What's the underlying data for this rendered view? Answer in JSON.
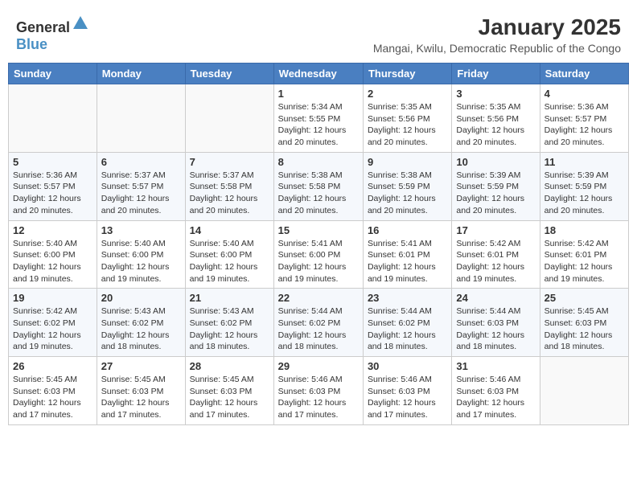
{
  "header": {
    "logo_general": "General",
    "logo_blue": "Blue",
    "month_year": "January 2025",
    "location": "Mangai, Kwilu, Democratic Republic of the Congo"
  },
  "weekdays": [
    "Sunday",
    "Monday",
    "Tuesday",
    "Wednesday",
    "Thursday",
    "Friday",
    "Saturday"
  ],
  "weeks": [
    [
      {
        "day": "",
        "sunrise": "",
        "sunset": "",
        "daylight": ""
      },
      {
        "day": "",
        "sunrise": "",
        "sunset": "",
        "daylight": ""
      },
      {
        "day": "",
        "sunrise": "",
        "sunset": "",
        "daylight": ""
      },
      {
        "day": "1",
        "sunrise": "Sunrise: 5:34 AM",
        "sunset": "Sunset: 5:55 PM",
        "daylight": "Daylight: 12 hours and 20 minutes."
      },
      {
        "day": "2",
        "sunrise": "Sunrise: 5:35 AM",
        "sunset": "Sunset: 5:56 PM",
        "daylight": "Daylight: 12 hours and 20 minutes."
      },
      {
        "day": "3",
        "sunrise": "Sunrise: 5:35 AM",
        "sunset": "Sunset: 5:56 PM",
        "daylight": "Daylight: 12 hours and 20 minutes."
      },
      {
        "day": "4",
        "sunrise": "Sunrise: 5:36 AM",
        "sunset": "Sunset: 5:57 PM",
        "daylight": "Daylight: 12 hours and 20 minutes."
      }
    ],
    [
      {
        "day": "5",
        "sunrise": "Sunrise: 5:36 AM",
        "sunset": "Sunset: 5:57 PM",
        "daylight": "Daylight: 12 hours and 20 minutes."
      },
      {
        "day": "6",
        "sunrise": "Sunrise: 5:37 AM",
        "sunset": "Sunset: 5:57 PM",
        "daylight": "Daylight: 12 hours and 20 minutes."
      },
      {
        "day": "7",
        "sunrise": "Sunrise: 5:37 AM",
        "sunset": "Sunset: 5:58 PM",
        "daylight": "Daylight: 12 hours and 20 minutes."
      },
      {
        "day": "8",
        "sunrise": "Sunrise: 5:38 AM",
        "sunset": "Sunset: 5:58 PM",
        "daylight": "Daylight: 12 hours and 20 minutes."
      },
      {
        "day": "9",
        "sunrise": "Sunrise: 5:38 AM",
        "sunset": "Sunset: 5:59 PM",
        "daylight": "Daylight: 12 hours and 20 minutes."
      },
      {
        "day": "10",
        "sunrise": "Sunrise: 5:39 AM",
        "sunset": "Sunset: 5:59 PM",
        "daylight": "Daylight: 12 hours and 20 minutes."
      },
      {
        "day": "11",
        "sunrise": "Sunrise: 5:39 AM",
        "sunset": "Sunset: 5:59 PM",
        "daylight": "Daylight: 12 hours and 20 minutes."
      }
    ],
    [
      {
        "day": "12",
        "sunrise": "Sunrise: 5:40 AM",
        "sunset": "Sunset: 6:00 PM",
        "daylight": "Daylight: 12 hours and 19 minutes."
      },
      {
        "day": "13",
        "sunrise": "Sunrise: 5:40 AM",
        "sunset": "Sunset: 6:00 PM",
        "daylight": "Daylight: 12 hours and 19 minutes."
      },
      {
        "day": "14",
        "sunrise": "Sunrise: 5:40 AM",
        "sunset": "Sunset: 6:00 PM",
        "daylight": "Daylight: 12 hours and 19 minutes."
      },
      {
        "day": "15",
        "sunrise": "Sunrise: 5:41 AM",
        "sunset": "Sunset: 6:00 PM",
        "daylight": "Daylight: 12 hours and 19 minutes."
      },
      {
        "day": "16",
        "sunrise": "Sunrise: 5:41 AM",
        "sunset": "Sunset: 6:01 PM",
        "daylight": "Daylight: 12 hours and 19 minutes."
      },
      {
        "day": "17",
        "sunrise": "Sunrise: 5:42 AM",
        "sunset": "Sunset: 6:01 PM",
        "daylight": "Daylight: 12 hours and 19 minutes."
      },
      {
        "day": "18",
        "sunrise": "Sunrise: 5:42 AM",
        "sunset": "Sunset: 6:01 PM",
        "daylight": "Daylight: 12 hours and 19 minutes."
      }
    ],
    [
      {
        "day": "19",
        "sunrise": "Sunrise: 5:42 AM",
        "sunset": "Sunset: 6:02 PM",
        "daylight": "Daylight: 12 hours and 19 minutes."
      },
      {
        "day": "20",
        "sunrise": "Sunrise: 5:43 AM",
        "sunset": "Sunset: 6:02 PM",
        "daylight": "Daylight: 12 hours and 18 minutes."
      },
      {
        "day": "21",
        "sunrise": "Sunrise: 5:43 AM",
        "sunset": "Sunset: 6:02 PM",
        "daylight": "Daylight: 12 hours and 18 minutes."
      },
      {
        "day": "22",
        "sunrise": "Sunrise: 5:44 AM",
        "sunset": "Sunset: 6:02 PM",
        "daylight": "Daylight: 12 hours and 18 minutes."
      },
      {
        "day": "23",
        "sunrise": "Sunrise: 5:44 AM",
        "sunset": "Sunset: 6:02 PM",
        "daylight": "Daylight: 12 hours and 18 minutes."
      },
      {
        "day": "24",
        "sunrise": "Sunrise: 5:44 AM",
        "sunset": "Sunset: 6:03 PM",
        "daylight": "Daylight: 12 hours and 18 minutes."
      },
      {
        "day": "25",
        "sunrise": "Sunrise: 5:45 AM",
        "sunset": "Sunset: 6:03 PM",
        "daylight": "Daylight: 12 hours and 18 minutes."
      }
    ],
    [
      {
        "day": "26",
        "sunrise": "Sunrise: 5:45 AM",
        "sunset": "Sunset: 6:03 PM",
        "daylight": "Daylight: 12 hours and 17 minutes."
      },
      {
        "day": "27",
        "sunrise": "Sunrise: 5:45 AM",
        "sunset": "Sunset: 6:03 PM",
        "daylight": "Daylight: 12 hours and 17 minutes."
      },
      {
        "day": "28",
        "sunrise": "Sunrise: 5:45 AM",
        "sunset": "Sunset: 6:03 PM",
        "daylight": "Daylight: 12 hours and 17 minutes."
      },
      {
        "day": "29",
        "sunrise": "Sunrise: 5:46 AM",
        "sunset": "Sunset: 6:03 PM",
        "daylight": "Daylight: 12 hours and 17 minutes."
      },
      {
        "day": "30",
        "sunrise": "Sunrise: 5:46 AM",
        "sunset": "Sunset: 6:03 PM",
        "daylight": "Daylight: 12 hours and 17 minutes."
      },
      {
        "day": "31",
        "sunrise": "Sunrise: 5:46 AM",
        "sunset": "Sunset: 6:03 PM",
        "daylight": "Daylight: 12 hours and 17 minutes."
      },
      {
        "day": "",
        "sunrise": "",
        "sunset": "",
        "daylight": ""
      }
    ]
  ]
}
